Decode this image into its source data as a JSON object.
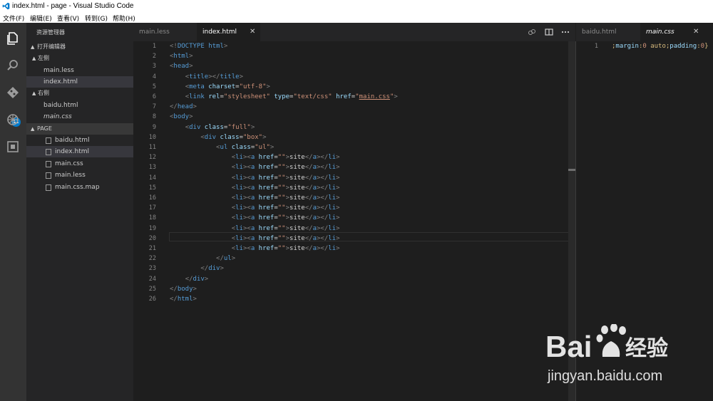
{
  "window": {
    "title": "index.html - page - Visual Studio Code"
  },
  "menu": [
    "文件(F)",
    "编辑(E)",
    "查看(V)",
    "转到(G)",
    "帮助(H)"
  ],
  "activity_bar": {
    "badge": "11"
  },
  "sidebar": {
    "header": "资源管理器",
    "open_editors_label": "打开编辑器",
    "group_left_label": "左侧",
    "group_left_files": [
      "main.less",
      "index.html"
    ],
    "group_right_label": "右侧",
    "group_right_files": [
      "baidu.html",
      "main.css"
    ],
    "folder_label": "PAGE",
    "folder_files": [
      "baidu.html",
      "index.html",
      "main.css",
      "main.less",
      "main.css.map"
    ]
  },
  "editor_left": {
    "tabs": [
      "main.less",
      "index.html"
    ],
    "active_tab": "index.html",
    "close_glyph": "✕",
    "line_numbers": [
      "1",
      "2",
      "3",
      "4",
      "5",
      "6",
      "7",
      "8",
      "9",
      "10",
      "11",
      "12",
      "13",
      "14",
      "15",
      "16",
      "17",
      "18",
      "19",
      "20",
      "21",
      "22",
      "23",
      "24",
      "25",
      "26"
    ],
    "lines": [
      {
        "text": "<!DOCTYPE html>"
      },
      {
        "text": "<html>"
      },
      {
        "text": "<head>"
      },
      {
        "text": "    <title></title>"
      },
      {
        "text": "    <meta charset=\"utf-8\">"
      },
      {
        "text": "    <link rel=\"stylesheet\" type=\"text/css\" href=\"main.css\">"
      },
      {
        "text": "</head>"
      },
      {
        "text": "<body>"
      },
      {
        "text": "    <div class=\"full\">"
      },
      {
        "text": "        <div class=\"box\">"
      },
      {
        "text": "            <ul class=\"ul\">"
      },
      {
        "text": "                <li><a href=\"\">site</a></li>"
      },
      {
        "text": "                <li><a href=\"\">site</a></li>"
      },
      {
        "text": "                <li><a href=\"\">site</a></li>"
      },
      {
        "text": "                <li><a href=\"\">site</a></li>"
      },
      {
        "text": "                <li><a href=\"\">site</a></li>"
      },
      {
        "text": "                <li><a href=\"\">site</a></li>"
      },
      {
        "text": "                <li><a href=\"\">site</a></li>"
      },
      {
        "text": "                <li><a href=\"\">site</a></li>"
      },
      {
        "text": "                <li><a href=\"\">site</a></li>"
      },
      {
        "text": "                <li><a href=\"\">site</a></li>"
      },
      {
        "text": "            </ul>"
      },
      {
        "text": "        </div>"
      },
      {
        "text": "    </div>"
      },
      {
        "text": "</body>"
      },
      {
        "text": "</html>"
      }
    ]
  },
  "editor_right": {
    "tabs": [
      "baidu.html",
      "main.css"
    ],
    "active_tab": "main.css",
    "close_glyph": "✕",
    "line_numbers": [
      "1"
    ],
    "lines": [
      {
        "text": ";margin:0 auto;padding:0}"
      }
    ]
  },
  "watermark": {
    "logo_text": "Baidu经验",
    "url": "jingyan.baidu.com"
  },
  "colors": {
    "tag": "#569cd6",
    "attr": "#9cdcfe",
    "string": "#ce9178",
    "text": "#d4d4d4",
    "accent": "#007acc"
  }
}
